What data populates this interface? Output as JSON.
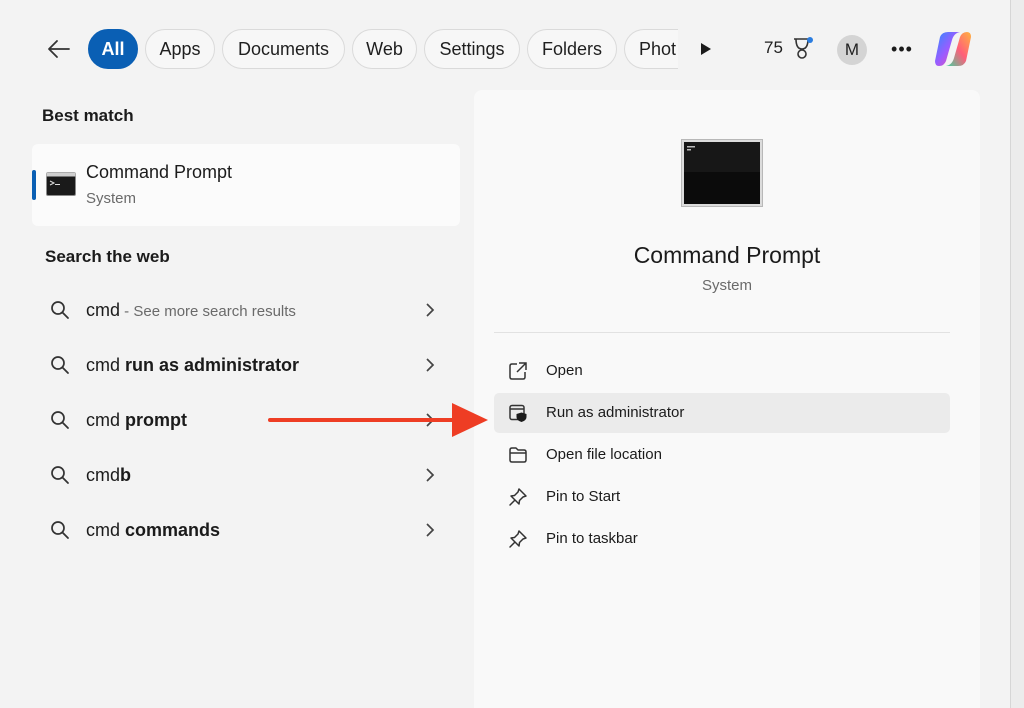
{
  "filters": {
    "back_label": "Back",
    "chips": [
      "All",
      "Apps",
      "Documents",
      "Web",
      "Settings",
      "Folders",
      "Phot"
    ],
    "points": "75",
    "avatar_initial": "M",
    "more": "•••"
  },
  "best_match": {
    "heading": "Best match",
    "title": "Command Prompt",
    "subtitle": "System"
  },
  "web": {
    "heading": "Search the web",
    "results": [
      {
        "prefix": "cmd",
        "bold": "",
        "hint": " - See more search results"
      },
      {
        "prefix": "cmd ",
        "bold": "run as administrator",
        "hint": ""
      },
      {
        "prefix": "cmd ",
        "bold": "prompt",
        "hint": ""
      },
      {
        "prefix": "cmd",
        "bold": "b",
        "hint": ""
      },
      {
        "prefix": "cmd ",
        "bold": "commands",
        "hint": ""
      }
    ]
  },
  "detail": {
    "title": "Command Prompt",
    "subtitle": "System",
    "actions": [
      {
        "label": "Open",
        "icon": "open-external-icon"
      },
      {
        "label": "Run as administrator",
        "icon": "admin-shield-icon"
      },
      {
        "label": "Open file location",
        "icon": "folder-icon"
      },
      {
        "label": "Pin to Start",
        "icon": "pin-icon"
      },
      {
        "label": "Pin to taskbar",
        "icon": "pin-icon"
      }
    ]
  },
  "colors": {
    "accent": "#0a5fb4",
    "arrow": "#ee3d24",
    "highlight_row": "#ebebeb"
  }
}
